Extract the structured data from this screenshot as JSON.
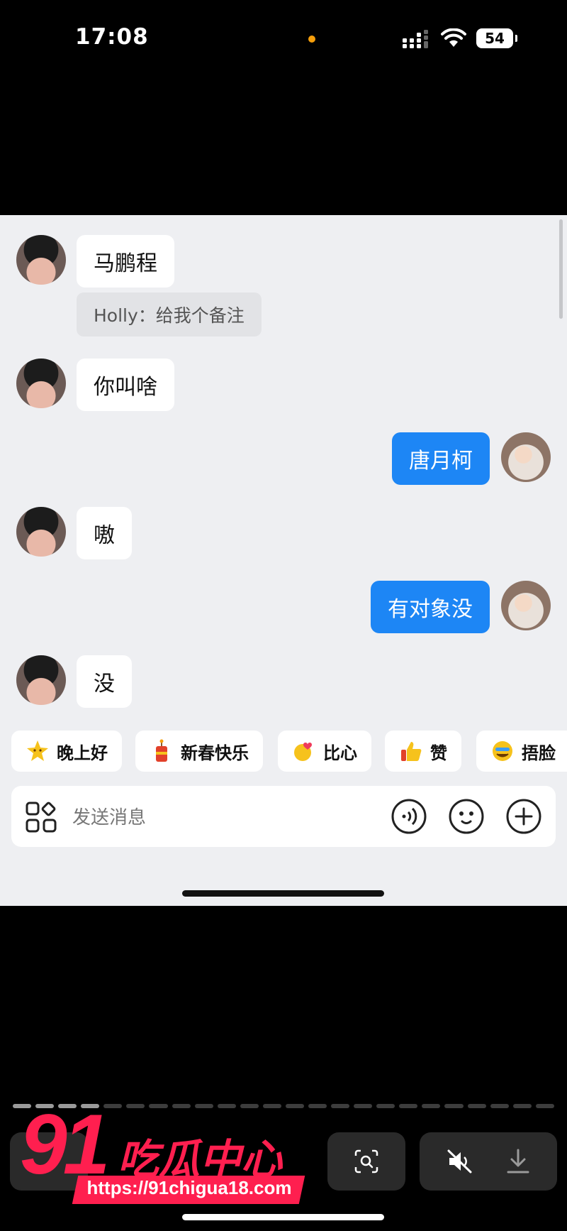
{
  "status_bar": {
    "time": "17:08",
    "battery": "54"
  },
  "messages": [
    {
      "side": "in",
      "text": "马鹏程"
    },
    {
      "type": "note",
      "text": "Holly：给我个备注"
    },
    {
      "side": "in",
      "text": "你叫啥"
    },
    {
      "side": "out",
      "text": "唐月柯"
    },
    {
      "side": "in",
      "text": "嗷"
    },
    {
      "side": "out",
      "text": "有对象没"
    },
    {
      "side": "in",
      "text": "没"
    }
  ],
  "quick_replies": [
    {
      "label": "晚上好",
      "icon": "star-face-icon"
    },
    {
      "label": "新春快乐",
      "icon": "firecracker-icon"
    },
    {
      "label": "比心",
      "icon": "heart-hand-icon"
    },
    {
      "label": "赞",
      "icon": "thumbs-up-icon"
    },
    {
      "label": "捂脸",
      "icon": "facepalm-icon"
    }
  ],
  "input": {
    "placeholder": "发送消息"
  },
  "video_progress": {
    "segments": 24,
    "watched_segments": 4
  },
  "watermark": {
    "number": "91",
    "name": "吃瓜中心",
    "url": "https://91chigua18.com"
  }
}
